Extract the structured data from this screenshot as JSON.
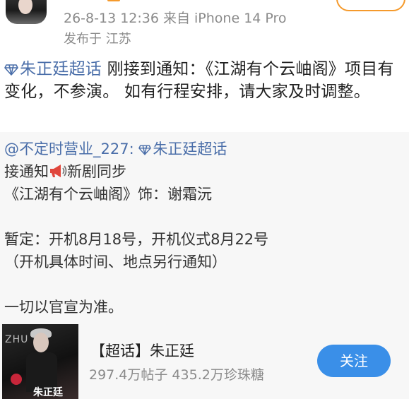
{
  "header": {
    "post_time": "26-8-13 12:36  来自 iPhone 14 Pro",
    "post_location": "发布于 江苏"
  },
  "post": {
    "topic": "朱正廷超话",
    "text": " 刚接到通知：《江湖有个云岫阁》项目有变化，不参演。 如有行程安排，请大家及时调整。"
  },
  "repost": {
    "mention": "@不定时营业_227:",
    "topic": "朱正廷超话",
    "line2_prefix": "接通知",
    "line2_suffix": "新剧同步",
    "line3": "《江湖有个云岫阁》饰：谢霜沅",
    "line5": "暂定：开机8月18号，开机仪式8月22号",
    "line6": "（开机具体时间、地点另行通知）",
    "line8": "一切以官宣为准。"
  },
  "card": {
    "title": "【超话】朱正廷",
    "stats": "297.4万帖子 435.2万珍珠糖",
    "follow_label": "关注",
    "thumb_name": "朱正廷",
    "thumb_mark": "ZHU"
  },
  "colors": {
    "link": "#4a6ea9",
    "follow_button": "#3a8fe8",
    "accent_orange": "#f59a2c",
    "repost_background": "#f7f7f7"
  }
}
